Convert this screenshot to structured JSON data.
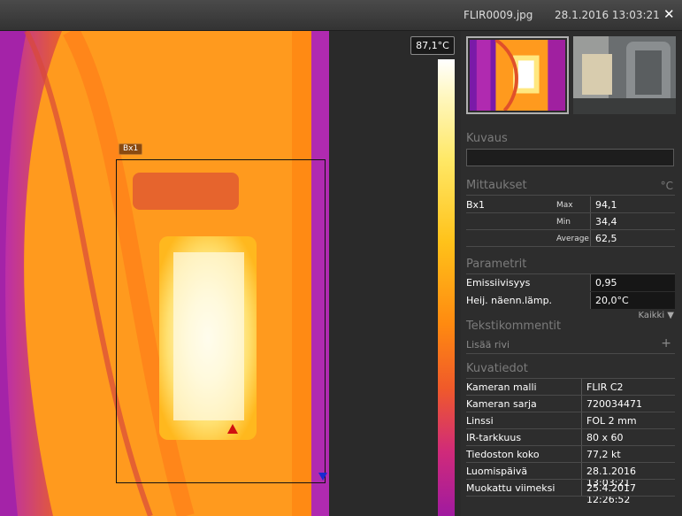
{
  "titlebar": {
    "filename": "FLIR0009.jpg",
    "datetime": "28.1.2016 13:03:21",
    "close_icon": "close-icon"
  },
  "viewer": {
    "box_label": "Bx1",
    "scale_max_label": "87,1°C",
    "max_marker_icon": "triangle-up-icon",
    "min_marker_icon": "triangle-down-icon"
  },
  "panel": {
    "thumbnails": [
      "thermal-thumbnail",
      "visual-thumbnail"
    ],
    "kuvaus": {
      "title": "Kuvaus",
      "value": ""
    },
    "mittaukset": {
      "title": "Mittaukset",
      "unit": "°C",
      "rows": [
        {
          "name": "Bx1",
          "stat": "Max",
          "value": "94,1"
        },
        {
          "name": "",
          "stat": "Min",
          "value": "34,4"
        },
        {
          "name": "",
          "stat": "Average",
          "value": "62,5"
        }
      ]
    },
    "parametrit": {
      "title": "Parametrit",
      "rows": [
        {
          "label": "Emissiivisyys",
          "value": "0,95"
        },
        {
          "label": "Heij. näenn.lämp.",
          "value": "20,0°C"
        }
      ],
      "all_label": "Kaikki ▼"
    },
    "tekstikommentit": {
      "title": "Tekstikommentit",
      "add_row": "Lisää rivi",
      "add_icon": "plus-icon"
    },
    "kuvatiedot": {
      "title": "Kuvatiedot",
      "rows": [
        {
          "label": "Kameran malli",
          "value": "FLIR C2"
        },
        {
          "label": "Kameran sarja",
          "value": "720034471"
        },
        {
          "label": "Linssi",
          "value": "FOL 2 mm"
        },
        {
          "label": "IR-tarkkuus",
          "value": "80 x 60"
        },
        {
          "label": "Tiedoston koko",
          "value": "77,2 kt"
        },
        {
          "label": "Luomispäivä",
          "value": "28.1.2016 13:03:21"
        },
        {
          "label": "Muokattu viimeksi",
          "value": "25.4.2017 12:26:52"
        }
      ]
    }
  }
}
